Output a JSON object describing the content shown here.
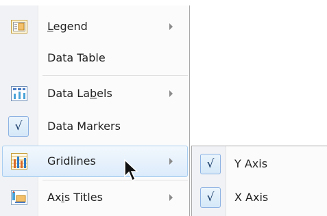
{
  "menu": {
    "items": [
      {
        "label": "Legend",
        "mnemonic_index": 0,
        "icon": "legend-icon",
        "has_submenu": true,
        "checked": false
      },
      {
        "label": "Data Table",
        "mnemonic_index": -1,
        "icon": "",
        "has_submenu": false,
        "checked": false
      },
      {
        "label": "Data Labels",
        "mnemonic_index": 7,
        "icon": "data-labels-icon",
        "has_submenu": true,
        "checked": false
      },
      {
        "label": "Data Markers",
        "mnemonic_index": -1,
        "icon": "",
        "has_submenu": false,
        "checked": true
      },
      {
        "label": "Gridlines",
        "mnemonic_index": -1,
        "icon": "gridlines-icon",
        "has_submenu": true,
        "checked": false,
        "highlighted": true
      },
      {
        "label": "Axis Titles",
        "mnemonic_index": 2,
        "icon": "axis-titles-icon",
        "has_submenu": true,
        "checked": false
      }
    ],
    "check_glyph": "√"
  },
  "submenu": {
    "items": [
      {
        "label": "Y Axis",
        "checked": true
      },
      {
        "label": "X Axis",
        "checked": true
      }
    ]
  },
  "colors": {
    "highlight_border": "#a7cdf0",
    "check_border": "#8db2e3",
    "menu_border": "#a9a9a9"
  }
}
